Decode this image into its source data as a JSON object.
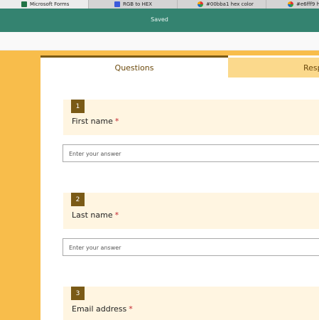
{
  "browser": {
    "tabs": [
      {
        "label": "Microsoft Forms",
        "icon": "forms-icon",
        "active": true
      },
      {
        "label": "RGB to HEX",
        "icon": "rgb-icon",
        "active": false
      },
      {
        "label": "#00bba1 hex color",
        "icon": "color-wheel-icon",
        "active": false
      },
      {
        "label": "#e6fff9 h",
        "icon": "color-wheel-icon",
        "active": false
      }
    ]
  },
  "header": {
    "status": "Saved",
    "color": "#348370"
  },
  "form_tabs": {
    "questions": "Questions",
    "responses": "Resp"
  },
  "questions": [
    {
      "number": "1",
      "title": "First name",
      "required_mark": "*",
      "placeholder": "Enter your answer"
    },
    {
      "number": "2",
      "title": "Last name",
      "required_mark": "*",
      "placeholder": "Enter your answer"
    },
    {
      "number": "3",
      "title": "Email address",
      "required_mark": "*"
    }
  ],
  "colors": {
    "background": "#f8bd4b",
    "accent": "#7a5a16",
    "question_bg": "#fff5e1",
    "required": "#c3262e"
  }
}
